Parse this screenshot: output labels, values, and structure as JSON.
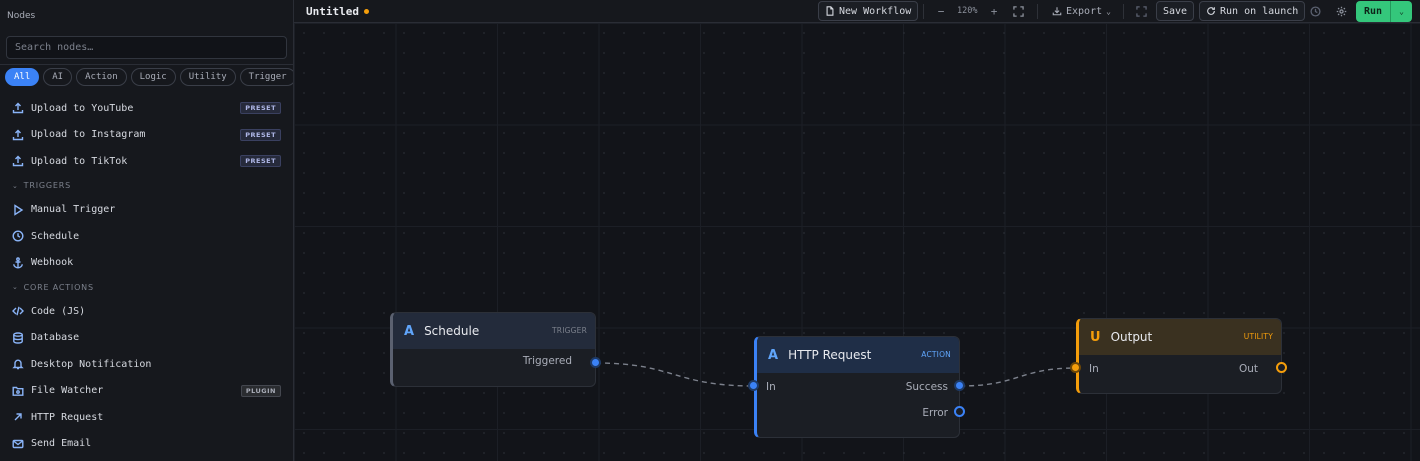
{
  "sidebar": {
    "title": "Nodes",
    "search_placeholder": "Search nodes…",
    "filters": [
      {
        "label": "All",
        "active": true
      },
      {
        "label": "AI",
        "active": false
      },
      {
        "label": "Action",
        "active": false
      },
      {
        "label": "Logic",
        "active": false
      },
      {
        "label": "Utility",
        "active": false
      },
      {
        "label": "Trigger",
        "active": false
      }
    ],
    "presets": [
      {
        "label": "Upload to YouTube",
        "icon": "upload-icon",
        "badge": "PRESET"
      },
      {
        "label": "Upload to Instagram",
        "icon": "upload-icon",
        "badge": "PRESET"
      },
      {
        "label": "Upload to TikTok",
        "icon": "upload-icon",
        "badge": "PRESET"
      }
    ],
    "triggers_section": "TRIGGERS",
    "triggers": [
      {
        "label": "Manual Trigger",
        "icon": "play-icon"
      },
      {
        "label": "Schedule",
        "icon": "clock-icon"
      },
      {
        "label": "Webhook",
        "icon": "anchor-icon"
      }
    ],
    "core_section": "CORE ACTIONS",
    "core_actions": [
      {
        "label": "Code (JS)",
        "icon": "code-icon"
      },
      {
        "label": "Database",
        "icon": "database-icon"
      },
      {
        "label": "Desktop Notification",
        "icon": "bell-icon"
      },
      {
        "label": "File Watcher",
        "icon": "folder-icon",
        "badge": "PLUGIN"
      },
      {
        "label": "HTTP Request",
        "icon": "arrow-up-right-icon"
      },
      {
        "label": "Send Email",
        "icon": "mail-icon"
      }
    ]
  },
  "toolbar": {
    "title": "Untitled",
    "new_workflow": "New Workflow",
    "zoom": "120%",
    "export": "Export",
    "save": "Save",
    "run_on_launch": "Run on launch",
    "run": "Run"
  },
  "nodes": {
    "schedule": {
      "glyph": "A",
      "name": "Schedule",
      "kind": "TRIGGER",
      "out": "Triggered"
    },
    "http": {
      "glyph": "A",
      "name": "HTTP Request",
      "kind": "ACTION",
      "in": "In",
      "success": "Success",
      "error": "Error"
    },
    "output": {
      "glyph": "U",
      "name": "Output",
      "kind": "UTILITY",
      "in": "In",
      "out": "Out"
    }
  },
  "colors": {
    "accent": "#3b82f6",
    "run": "#34c77b",
    "utility": "#f59e0b"
  }
}
